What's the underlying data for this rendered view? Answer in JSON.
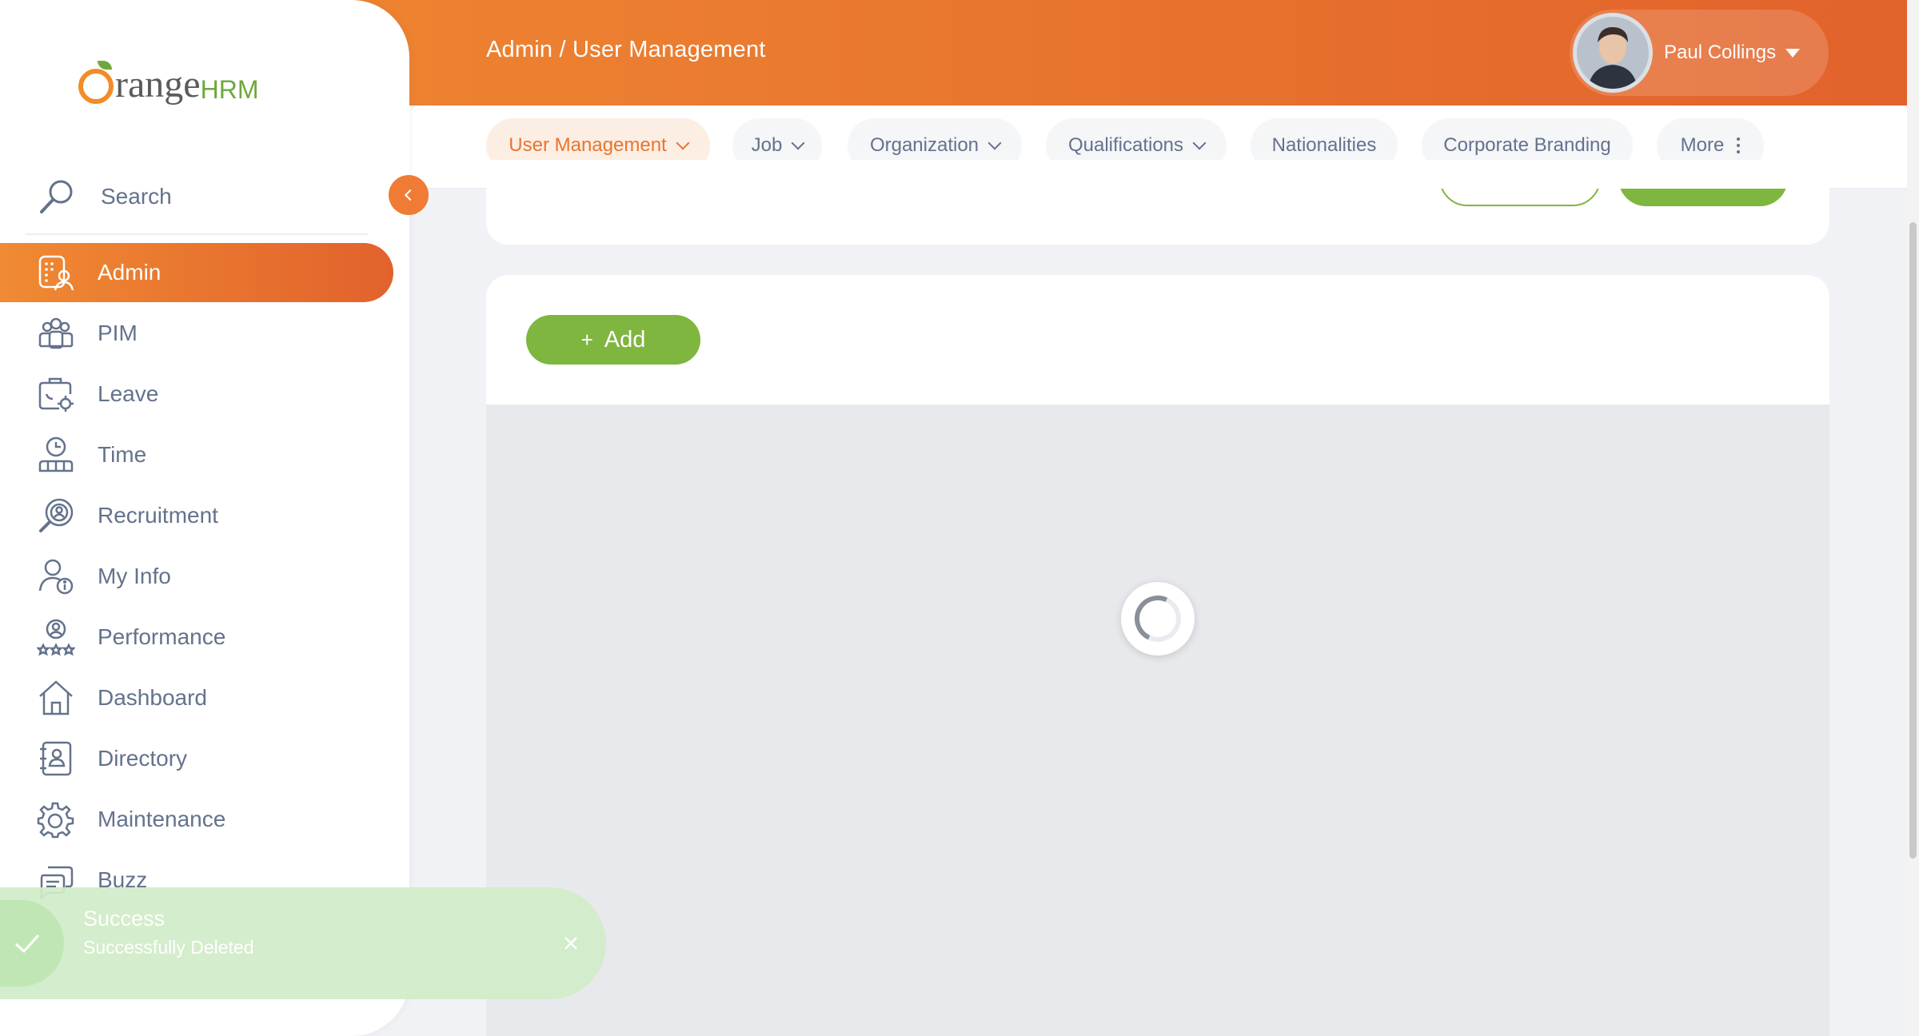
{
  "header": {
    "breadcrumb": "Admin / User Management",
    "user_name": "Paul Collings"
  },
  "tabs": [
    {
      "label": "User Management",
      "has_dropdown": true,
      "active": true
    },
    {
      "label": "Job",
      "has_dropdown": true
    },
    {
      "label": "Organization",
      "has_dropdown": true
    },
    {
      "label": "Qualifications",
      "has_dropdown": true
    },
    {
      "label": "Nationalities",
      "has_dropdown": false
    },
    {
      "label": "Corporate Branding",
      "has_dropdown": false
    },
    {
      "label": "More",
      "has_dropdown": false
    }
  ],
  "sidebar": {
    "logo_text_1": "range",
    "logo_text_2": "HRM",
    "search_label": "Search",
    "items": [
      {
        "label": "Admin",
        "icon": "admin-icon",
        "active": true
      },
      {
        "label": "PIM",
        "icon": "pim-icon"
      },
      {
        "label": "Leave",
        "icon": "leave-icon"
      },
      {
        "label": "Time",
        "icon": "time-icon"
      },
      {
        "label": "Recruitment",
        "icon": "recruitment-icon"
      },
      {
        "label": "My Info",
        "icon": "my-info-icon"
      },
      {
        "label": "Performance",
        "icon": "performance-icon"
      },
      {
        "label": "Dashboard",
        "icon": "dashboard-icon"
      },
      {
        "label": "Directory",
        "icon": "directory-icon"
      },
      {
        "label": "Maintenance",
        "icon": "maintenance-icon"
      },
      {
        "label": "Buzz",
        "icon": "buzz-icon"
      }
    ]
  },
  "main": {
    "add_label": "Add"
  },
  "toast": {
    "title": "Success",
    "message": "Successfully Deleted"
  },
  "colors": {
    "brand_orange": "#e8752e",
    "accent_green": "#7eb63f",
    "text_gray": "#64728c"
  }
}
